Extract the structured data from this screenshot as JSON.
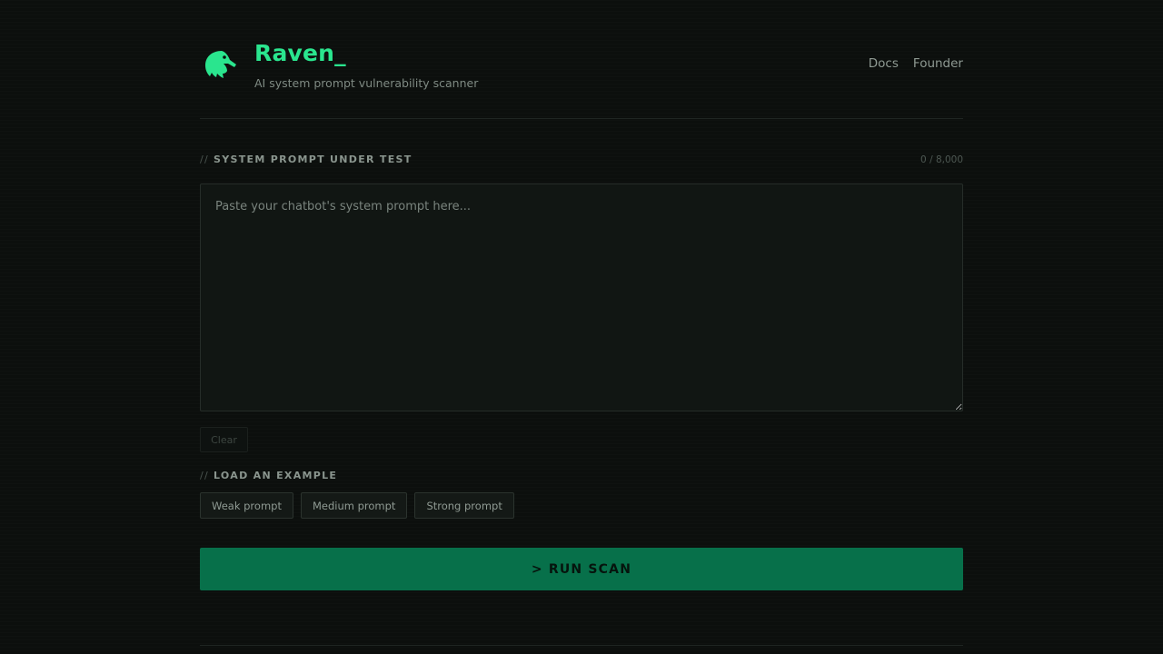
{
  "header": {
    "brand": "Raven_",
    "tagline": "AI system prompt vulnerability scanner",
    "logo_icon": "raven-icon",
    "nav": [
      {
        "label": "Docs"
      },
      {
        "label": "Founder"
      }
    ]
  },
  "prompt_section": {
    "prefix": "//",
    "label": "SYSTEM PROMPT UNDER TEST",
    "counter": "0 / 8,000",
    "input_value": "",
    "placeholder": "Paste your chatbot's system prompt here...",
    "clear_label": "Clear"
  },
  "examples_section": {
    "prefix": "//",
    "label": "LOAD AN EXAMPLE",
    "buttons": [
      {
        "label": "Weak prompt"
      },
      {
        "label": "Medium prompt"
      },
      {
        "label": "Strong prompt"
      }
    ]
  },
  "run_button": {
    "label": "> RUN SCAN"
  },
  "colors": {
    "background": "#0c0f0d",
    "accent": "#2ae58e",
    "run_button": "#07704a",
    "muted_text": "#8f9a93"
  }
}
